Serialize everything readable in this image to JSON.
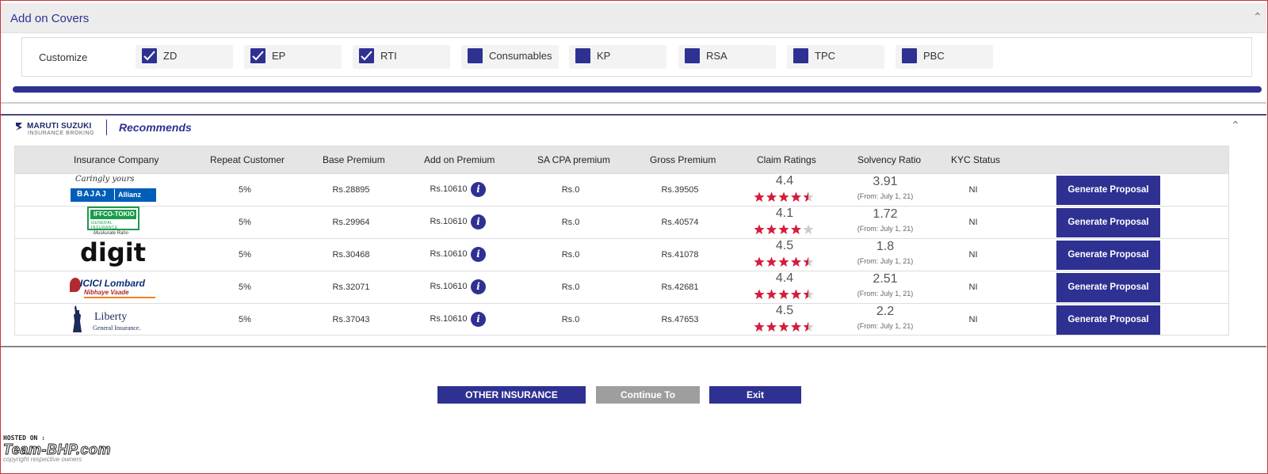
{
  "addon": {
    "title": "Add on Covers",
    "customize_label": "Customize",
    "covers": [
      {
        "label": "ZD",
        "checked": true
      },
      {
        "label": "EP",
        "checked": true
      },
      {
        "label": "RTI",
        "checked": true
      },
      {
        "label": "Consumables",
        "checked": false
      },
      {
        "label": "KP",
        "checked": false
      },
      {
        "label": "RSA",
        "checked": false
      },
      {
        "label": "TPC",
        "checked": false
      },
      {
        "label": "PBC",
        "checked": false
      }
    ],
    "progress_fraction": 1.0
  },
  "brand": {
    "name": "MARUTI SUZUKI",
    "sub": "INSURANCE BROKING",
    "recommends": "Recommends"
  },
  "table": {
    "headers": [
      "Insurance Company",
      "Repeat Customer",
      "Base Premium",
      "Add on Premium",
      "SA CPA premium",
      "Gross Premium",
      "Claim Ratings",
      "Solvency Ratio",
      "KYC Status"
    ],
    "rows": [
      {
        "company": "Bajaj Allianz",
        "logo_top": "Caringly yours",
        "logo_main": "BAJAJ",
        "logo_sub": "Allianz",
        "repeat": "5%",
        "base": "Rs.28895",
        "addon": "Rs.10610",
        "cpa": "Rs.0",
        "gross": "Rs.39505",
        "rating": "4.4",
        "rating_value": 4.4,
        "solvency": "3.91",
        "solvency_note": "(From: July 1, 21)",
        "kyc": "NI",
        "action": "Generate Proposal"
      },
      {
        "company": "IFFCO-TOKIO",
        "logo_top": "IFFCO-TOKIO",
        "logo_main": "GENERAL INSURANCE",
        "logo_sub": "Muskurate Raho",
        "repeat": "5%",
        "base": "Rs.29964",
        "addon": "Rs.10610",
        "cpa": "Rs.0",
        "gross": "Rs.40574",
        "rating": "4.1",
        "rating_value": 4.1,
        "solvency": "1.72",
        "solvency_note": "(From: July 1, 21)",
        "kyc": "NI",
        "action": "Generate Proposal"
      },
      {
        "company": "digit",
        "logo_top": "",
        "logo_main": "digit",
        "logo_sub": "",
        "repeat": "5%",
        "base": "Rs.30468",
        "addon": "Rs.10610",
        "cpa": "Rs.0",
        "gross": "Rs.41078",
        "rating": "4.5",
        "rating_value": 4.5,
        "solvency": "1.8",
        "solvency_note": "(From: July 1, 21)",
        "kyc": "NI",
        "action": "Generate Proposal"
      },
      {
        "company": "ICICI Lombard",
        "logo_top": "",
        "logo_main": "ICICI Lombard",
        "logo_sub": "Nibhaye Vaade",
        "repeat": "5%",
        "base": "Rs.32071",
        "addon": "Rs.10610",
        "cpa": "Rs.0",
        "gross": "Rs.42681",
        "rating": "4.4",
        "rating_value": 4.4,
        "solvency": "2.51",
        "solvency_note": "(From: July 1, 21)",
        "kyc": "NI",
        "action": "Generate Proposal"
      },
      {
        "company": "Liberty General Insurance",
        "logo_top": "",
        "logo_main": "Liberty",
        "logo_sub": "General Insurance.",
        "repeat": "5%",
        "base": "Rs.37043",
        "addon": "Rs.10610",
        "cpa": "Rs.0",
        "gross": "Rs.47653",
        "rating": "4.5",
        "rating_value": 4.5,
        "solvency": "2.2",
        "solvency_note": "(From: July 1, 21)",
        "kyc": "NI",
        "action": "Generate Proposal"
      }
    ]
  },
  "buttons": {
    "other": "OTHER INSURANCE COMPANIES",
    "continue": "Continue To Receipting",
    "exit": "Exit"
  },
  "watermark": {
    "hosted": "HOSTED ON :",
    "brand": "Team-BHP.com",
    "copyright": "copyright respective owners"
  },
  "colors": {
    "accent": "#2e3192",
    "star": "#d81b3c",
    "star_empty": "#cccccc",
    "button_disabled": "#9e9e9e"
  }
}
